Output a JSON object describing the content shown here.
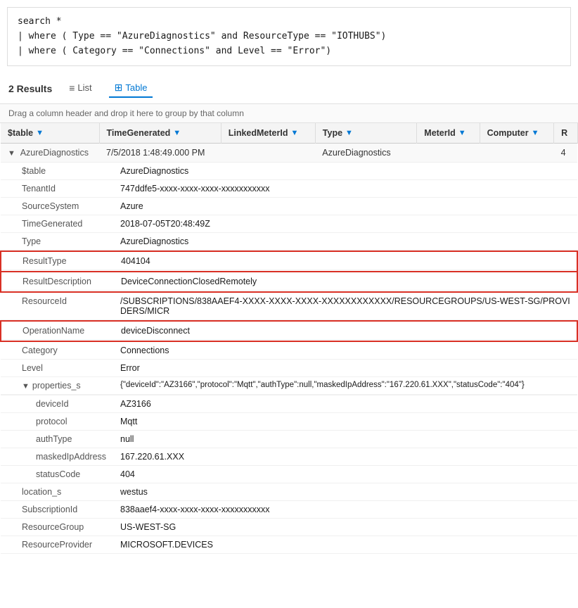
{
  "query": {
    "lines": [
      "search *",
      "| where ( Type == \"AzureDiagnostics\" and ResourceType == \"IOTHUBS\")",
      "| where ( Category == \"Connections\" and Level == \"Error\")"
    ]
  },
  "results_bar": {
    "count_label": "2 Results",
    "tabs": [
      {
        "id": "list",
        "label": "List",
        "icon": "≡",
        "active": false
      },
      {
        "id": "table",
        "label": "Table",
        "icon": "⊞",
        "active": true
      }
    ]
  },
  "drag_hint": "Drag a column header and drop it here to group by that column",
  "columns": [
    {
      "id": "stable",
      "label": "$table"
    },
    {
      "id": "timegenerated",
      "label": "TimeGenerated"
    },
    {
      "id": "linkedmeterid",
      "label": "LinkedMeterId"
    },
    {
      "id": "type",
      "label": "Type"
    },
    {
      "id": "meterid",
      "label": "MeterId"
    },
    {
      "id": "computer",
      "label": "Computer"
    },
    {
      "id": "r",
      "label": "R"
    }
  ],
  "main_row": {
    "expand": "▼",
    "stable": "AzureDiagnostics",
    "timegenerated": "7/5/2018 1:48:49.000 PM",
    "linkedmeterid": "",
    "type": "AzureDiagnostics",
    "meterid": "",
    "computer": "",
    "r": "4"
  },
  "detail_rows": [
    {
      "key": "$table",
      "value": "AzureDiagnostics",
      "highlighted": false,
      "expandable": false
    },
    {
      "key": "TenantId",
      "value": "747ddfe5-xxxx-xxxx-xxxx-xxxxxxxxxxx",
      "highlighted": false,
      "expandable": false
    },
    {
      "key": "SourceSystem",
      "value": "Azure",
      "highlighted": false,
      "expandable": false
    },
    {
      "key": "TimeGenerated",
      "value": "2018-07-05T20:48:49Z",
      "highlighted": false,
      "expandable": false
    },
    {
      "key": "Type",
      "value": "AzureDiagnostics",
      "highlighted": false,
      "expandable": false
    },
    {
      "key": "ResultType",
      "value": "404104",
      "highlighted": true,
      "expandable": false
    },
    {
      "key": "ResultDescription",
      "value": "DeviceConnectionClosedRemotely",
      "highlighted": true,
      "expandable": false
    },
    {
      "key": "ResourceId",
      "value": "/SUBSCRIPTIONS/838AAEF4-XXXX-XXXX-XXXX-XXXXXXXXXXXX/RESOURCEGROUPS/US-WEST-SG/PROVIDERS/MICR",
      "highlighted": false,
      "expandable": false
    },
    {
      "key": "OperationName",
      "value": "deviceDisconnect",
      "highlighted": true,
      "expandable": false
    },
    {
      "key": "Category",
      "value": "Connections",
      "highlighted": false,
      "expandable": false
    },
    {
      "key": "Level",
      "value": "Error",
      "highlighted": false,
      "expandable": false
    },
    {
      "key": "properties_s",
      "value": "{\"deviceId\":\"AZ3166\",\"protocol\":\"Mqtt\",\"authType\":null,\"maskedIpAddress\":\"167.220.61.XXX\",\"statusCode\":\"404\"}",
      "highlighted": false,
      "expandable": true,
      "expanded": true,
      "children": [
        {
          "key": "deviceId",
          "value": "AZ3166"
        },
        {
          "key": "protocol",
          "value": "Mqtt"
        },
        {
          "key": "authType",
          "value": "null"
        },
        {
          "key": "maskedIpAddress",
          "value": "167.220.61.XXX"
        },
        {
          "key": "statusCode",
          "value": "404"
        }
      ]
    },
    {
      "key": "location_s",
      "value": "westus",
      "highlighted": false,
      "expandable": false
    },
    {
      "key": "SubscriptionId",
      "value": "838aaef4-xxxx-xxxx-xxxx-xxxxxxxxxxx",
      "highlighted": false,
      "expandable": false
    },
    {
      "key": "ResourceGroup",
      "value": "US-WEST-SG",
      "highlighted": false,
      "expandable": false
    },
    {
      "key": "ResourceProvider",
      "value": "MICROSOFT.DEVICES",
      "highlighted": false,
      "expandable": false
    }
  ]
}
